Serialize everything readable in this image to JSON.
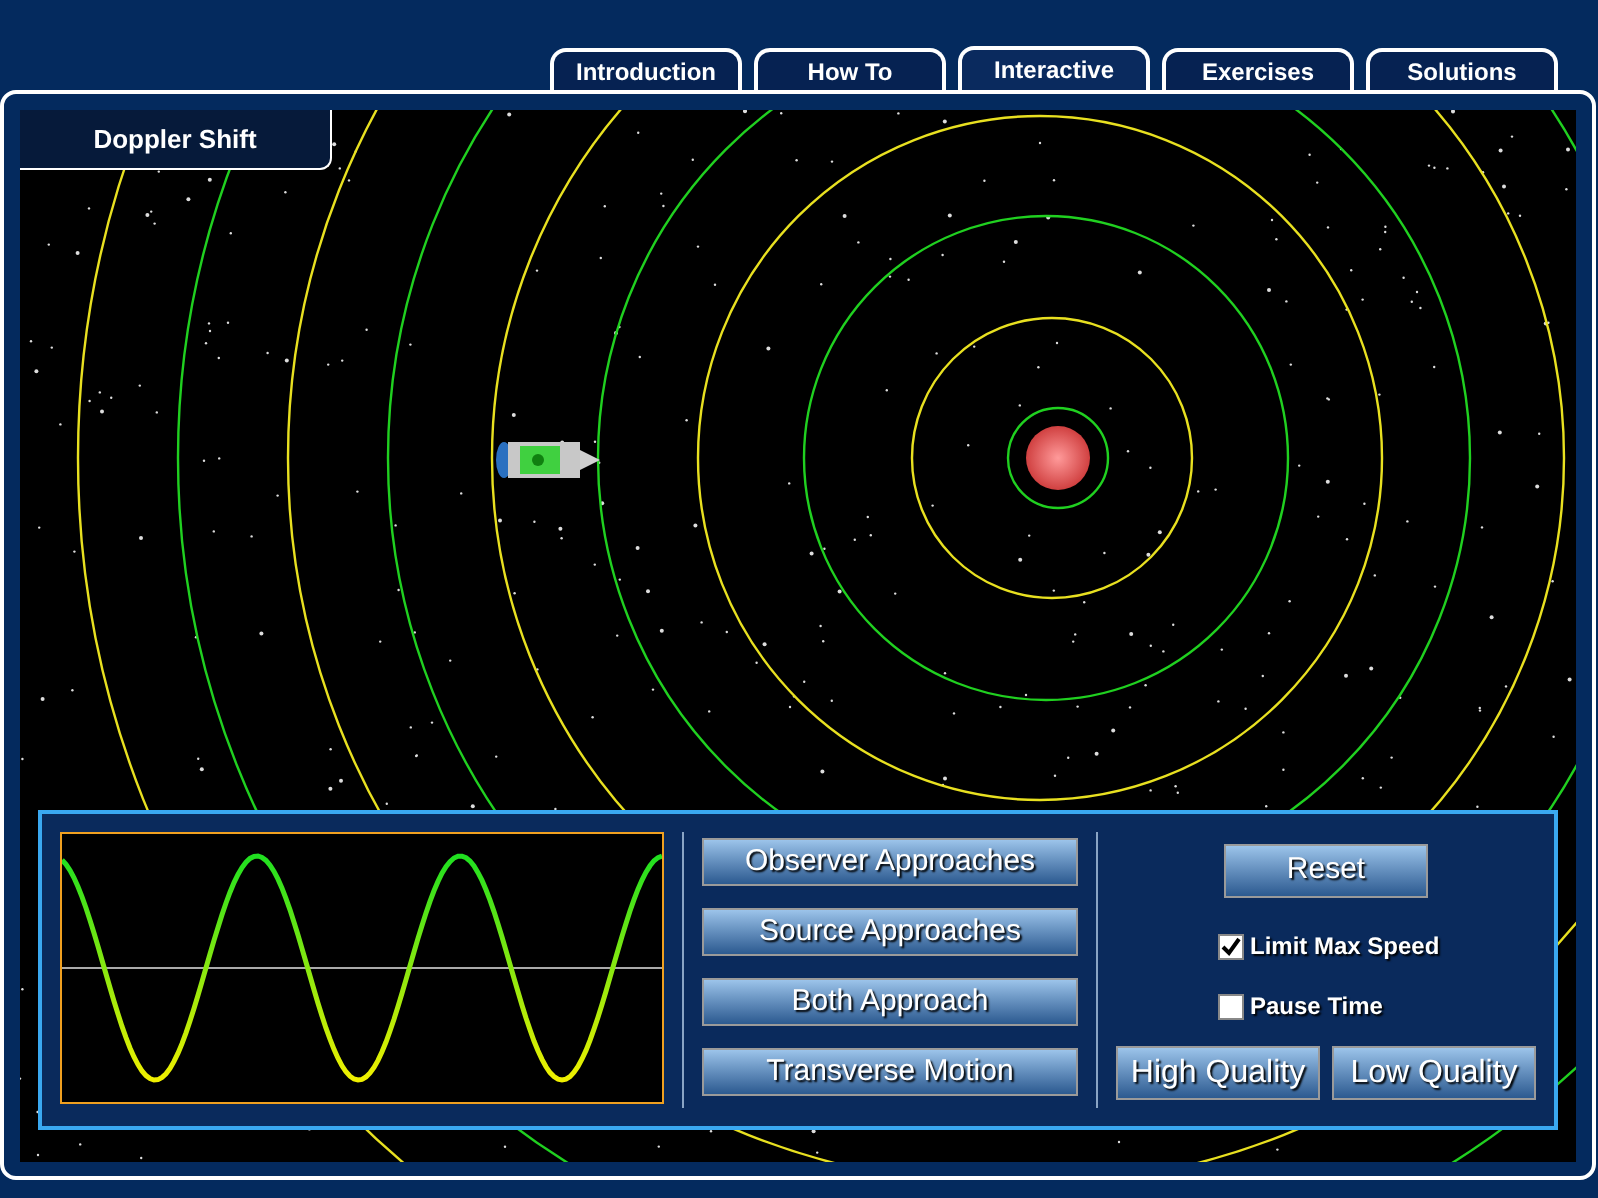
{
  "tabs": [
    {
      "label": "Introduction",
      "selected": false
    },
    {
      "label": "How To",
      "selected": false
    },
    {
      "label": "Interactive",
      "selected": true
    },
    {
      "label": "Exercises",
      "selected": false
    },
    {
      "label": "Solutions",
      "selected": false
    }
  ],
  "page_title": "Doppler Shift",
  "scenario_buttons": [
    "Observer Approaches",
    "Source Approaches",
    "Both Approach",
    "Transverse Motion"
  ],
  "reset_button": "Reset",
  "options": [
    {
      "label": "Limit Max Speed",
      "checked": true
    },
    {
      "label": "Pause Time",
      "checked": false
    }
  ],
  "quality_buttons": [
    "High Quality",
    "Low Quality"
  ]
}
